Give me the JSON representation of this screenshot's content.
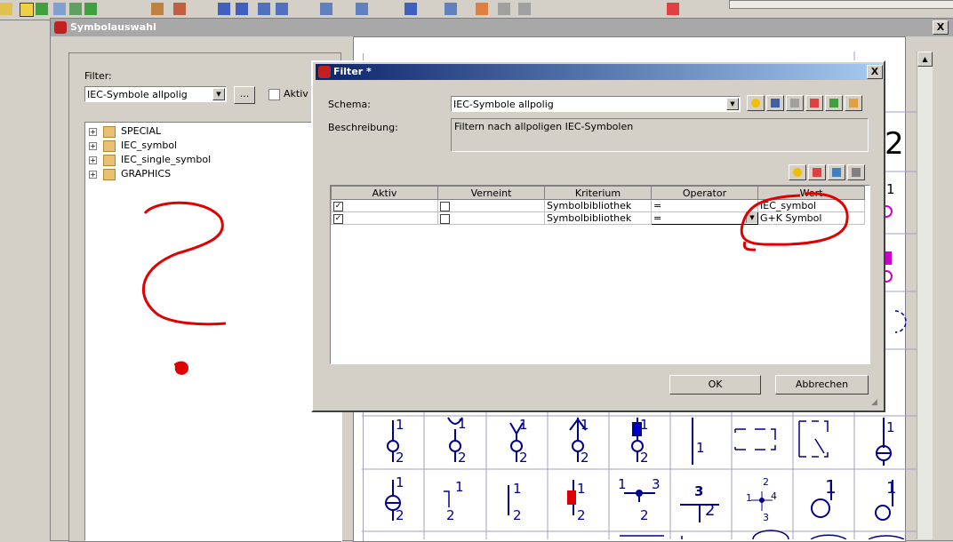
{
  "toolbar": {
    "icons": [
      "toolbar-icon"
    ]
  },
  "symbol_window": {
    "title": "Symbolauswahl",
    "close_label": "X",
    "filter_label": "Filter:",
    "filter_value": "IEC-Symbole allpolig",
    "browse_label": "...",
    "aktiv_label": "Aktiv",
    "tree_items": [
      "SPECIAL",
      "IEC_symbol",
      "IEC_single_symbol",
      "GRAPHICS"
    ]
  },
  "symbol_grid": {
    "row1_labels": [
      "1",
      "2",
      "1",
      "2",
      "1",
      "2",
      "1",
      "2",
      "1",
      "2",
      "1",
      "1",
      "2",
      "1"
    ],
    "row2_labels": [
      "1",
      "2",
      "1",
      "2",
      "1",
      "2",
      "1",
      "2",
      "1",
      "3",
      "2",
      "3",
      "2",
      "2",
      "4",
      "1",
      "3",
      "1",
      "1"
    ]
  },
  "filter_dialog": {
    "title": "Filter *",
    "close_label": "X",
    "schema_label": "Schema:",
    "schema_value": "IEC-Symbole allpolig",
    "description_label": "Beschreibung:",
    "description_value": "Filtern nach allpoligen IEC-Symbolen",
    "columns": [
      "Aktiv",
      "Verneint",
      "Kriterium",
      "Operator",
      "Wert"
    ],
    "rows": [
      {
        "aktiv": true,
        "verneint": false,
        "kriterium": "Symbolbibliothek",
        "operator": "=",
        "wert": "IEC_symbol"
      },
      {
        "aktiv": true,
        "verneint": false,
        "kriterium": "Symbolbibliothek",
        "operator": "=",
        "wert": "G+K Symbol"
      }
    ],
    "ok_label": "OK",
    "cancel_label": "Abbrechen"
  },
  "colors": {
    "accent": "#0a246a",
    "annotation": "#e00000",
    "symbol": "#00008b"
  }
}
